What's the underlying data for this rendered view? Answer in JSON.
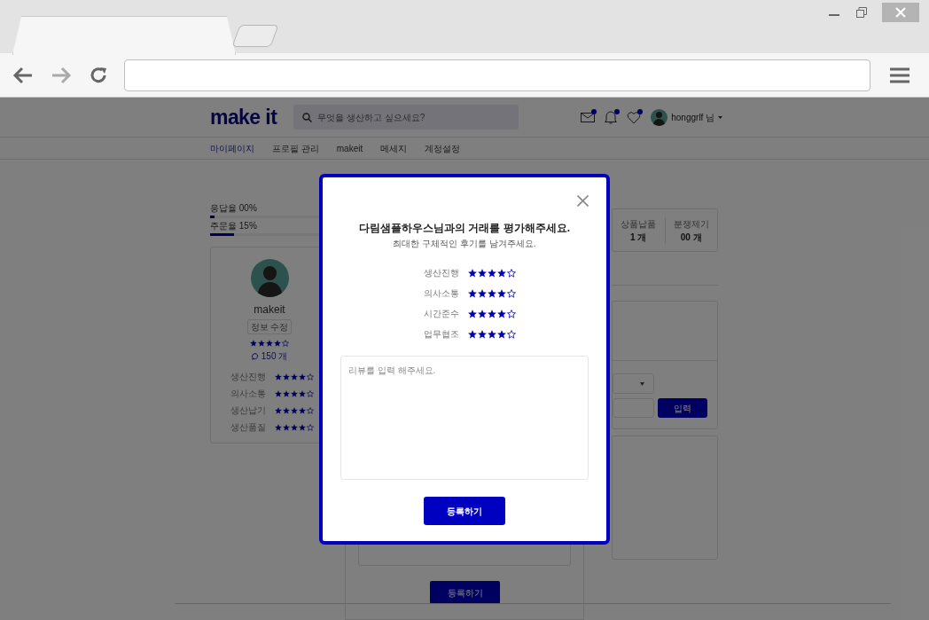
{
  "header": {
    "logo": "make it",
    "search": {
      "placeholder": "무엇을 생산하고 싶으세요?"
    },
    "alerts": [
      {
        "kind": "mail",
        "unread": true
      },
      {
        "kind": "bell",
        "unread": true
      },
      {
        "kind": "heart",
        "unread": true
      }
    ],
    "user": "honggrlf 님"
  },
  "nav": [
    {
      "label": "마이페이지",
      "selected": true
    },
    {
      "label": "프로필 관리",
      "selected": false
    },
    {
      "label": "makeit",
      "selected": false
    },
    {
      "label": "메세지",
      "selected": false
    },
    {
      "label": "계정설정",
      "selected": false
    }
  ],
  "progress": [
    {
      "label": "응답율 00%",
      "level": 0.03
    },
    {
      "label": "주문율 15%",
      "level": 0.15
    }
  ],
  "profile": {
    "name": "makeit",
    "edit_button": "정보 수정",
    "stars": 4,
    "review_count": "150 개",
    "ratings": [
      {
        "label": "생산진행",
        "stars": 4
      },
      {
        "label": "의사소통",
        "stars": 4
      },
      {
        "label": "생산납기",
        "stars": 4
      },
      {
        "label": "생산품질",
        "stars": 4
      }
    ]
  },
  "stats": [
    {
      "label": "상품납품",
      "value": "1 개"
    },
    {
      "label": "분쟁제기",
      "value": "00 개"
    }
  ],
  "input_button": "입력",
  "bottom_button": "등록하기",
  "modal": {
    "title": "다림샘플하우스님과의 거래를 평가해주세요.",
    "subtitle": "최대한 구체적인 후기를 남겨주세요.",
    "ratings": [
      {
        "label": "생산진행",
        "stars": 4
      },
      {
        "label": "의사소통",
        "stars": 4
      },
      {
        "label": "시간준수",
        "stars": 4
      },
      {
        "label": "업무협조",
        "stars": 4
      }
    ],
    "review": {
      "placeholder": "리뷰를 입력 해주세요."
    },
    "submit": "등록하기"
  }
}
